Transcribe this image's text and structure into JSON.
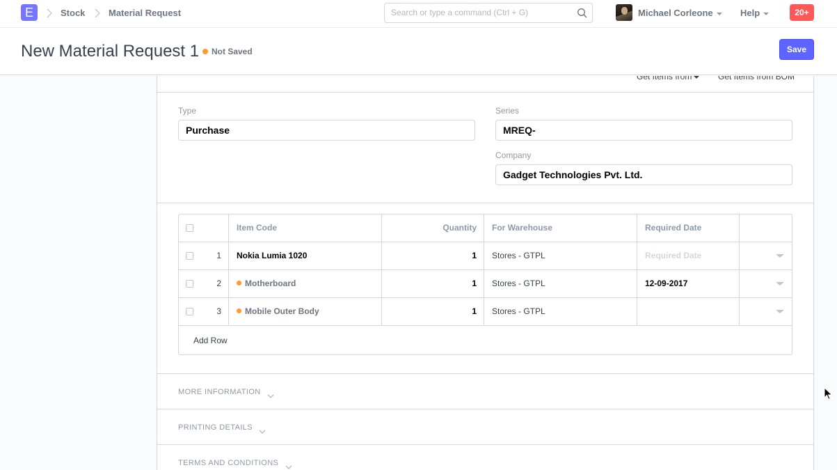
{
  "navbar": {
    "logo_letter": "E",
    "breadcrumbs": [
      "Stock",
      "Material Request"
    ],
    "search_placeholder": "Search or type a command (Ctrl + G)",
    "user_name": "Michael Corleone",
    "help_label": "Help",
    "notification_count": "20+"
  },
  "page": {
    "title": "New Material Request 1",
    "status": "Not Saved",
    "status_color": "#ff9a2e",
    "save_label": "Save"
  },
  "toolbar": {
    "get_items_from": "Get Items from",
    "get_items_from_bom": "Get Items from BOM"
  },
  "form": {
    "type_label": "Type",
    "type_value": "Purchase",
    "series_label": "Series",
    "series_value": "MREQ-",
    "company_label": "Company",
    "company_value": "Gadget Technologies Pvt. Ltd."
  },
  "items_table": {
    "headers": [
      "Item Code",
      "Quantity",
      "For Warehouse",
      "Required Date"
    ],
    "rows": [
      {
        "idx": "1",
        "item_code": "Nokia Lumia 1020",
        "qty": "1",
        "warehouse": "Stores - GTPL",
        "required_date": "",
        "required_date_placeholder": "Required Date",
        "indicator": ""
      },
      {
        "idx": "2",
        "item_code": "Motherboard",
        "qty": "1",
        "warehouse": "Stores - GTPL",
        "required_date": "12-09-2017",
        "required_date_placeholder": "",
        "indicator": "#ff9a2e"
      },
      {
        "idx": "3",
        "item_code": "Mobile Outer Body",
        "qty": "1",
        "warehouse": "Stores - GTPL",
        "required_date": "",
        "required_date_placeholder": "",
        "indicator": "#ff9a2e"
      }
    ],
    "add_row_label": "Add Row"
  },
  "sections": [
    "MORE INFORMATION",
    "PRINTING DETAILS",
    "TERMS AND CONDITIONS"
  ],
  "colors": {
    "primary": "#5e64ff",
    "notification": "#ff5858",
    "indicator_orange": "#ff9a2e"
  }
}
